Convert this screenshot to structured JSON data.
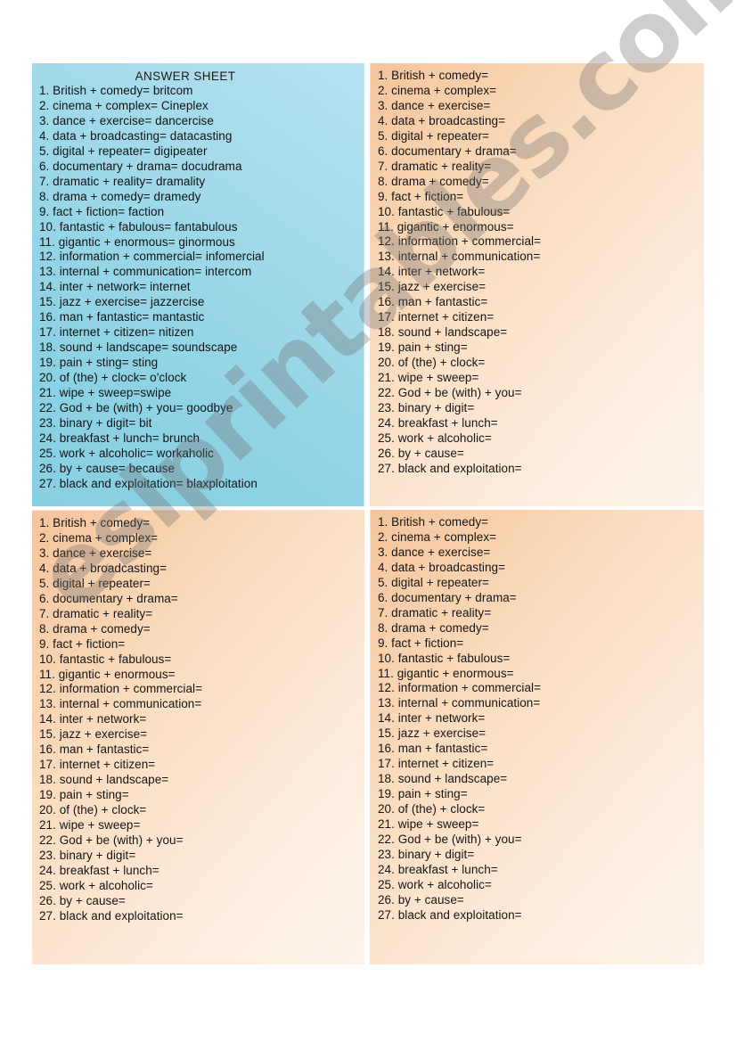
{
  "document": {
    "kind": "esl-worksheet",
    "watermark": "eslprintables.com",
    "page_background": "#ffffff"
  },
  "colors": {
    "answer_panel_top": "#b4e1ef",
    "answer_panel_bottom": "#87cfe2",
    "blank_panel_top": "#f4c49c",
    "blank_panel_bottom": "#fdf2e8",
    "text": "#151515",
    "watermark": "#6e6e6e"
  },
  "panels": {
    "answer_key": {
      "title": "ANSWER SHEET",
      "items": [
        "1. British + comedy= britcom",
        "2. cinema + complex= Cineplex",
        "3. dance + exercise= dancercise",
        "4. data + broadcasting= datacasting",
        "5. digital + repeater= digipeater",
        "6. documentary + drama= docudrama",
        "7. dramatic + reality= dramality",
        "8. drama + comedy= dramedy",
        "9. fact + fiction= faction",
        "10. fantastic + fabulous= fantabulous",
        "11. gigantic + enormous= ginormous",
        "12. information + commercial= infomercial",
        "13. internal + communication= intercom",
        "14. inter + network= internet",
        "15. jazz + exercise= jazzercise",
        "16. man + fantastic= mantastic",
        "17. internet + citizen= nitizen",
        "18. sound + landscape= soundscape",
        "19. pain + sting= sting",
        "20. of (the) + clock= o'clock",
        "21. wipe + sweep=swipe",
        "22. God + be (with) + you= goodbye",
        "23. binary + digit= bit",
        "24. breakfast + lunch= brunch",
        "25. work + alcoholic= workaholic",
        "26. by + cause= because",
        "27. black and exploitation= blaxploitation"
      ]
    },
    "blank": {
      "items": [
        "1. British + comedy=",
        "2. cinema + complex=",
        "3. dance + exercise=",
        "4. data + broadcasting=",
        "5. digital + repeater=",
        "6. documentary + drama=",
        "7. dramatic + reality=",
        "8. drama + comedy=",
        "9. fact + fiction=",
        "10. fantastic + fabulous=",
        "11. gigantic + enormous=",
        "12. information + commercial=",
        "13. internal + communication=",
        "14. inter + network=",
        "15. jazz + exercise=",
        "16. man + fantastic=",
        "17. internet + citizen=",
        "18. sound + landscape=",
        "19. pain + sting=",
        "20. of (the) + clock=",
        "21. wipe + sweep=",
        "22. God + be (with) + you=",
        "23. binary + digit=",
        "24. breakfast + lunch=",
        "25. work + alcoholic=",
        "26. by + cause=",
        "27. black and exploitation="
      ]
    }
  }
}
